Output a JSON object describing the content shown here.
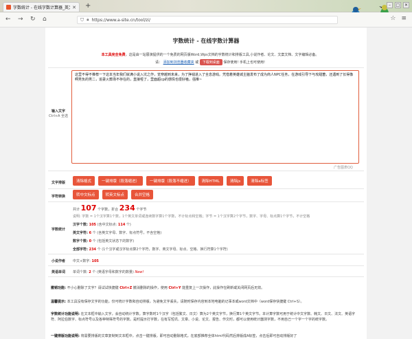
{
  "browser": {
    "tab_title": "字数统计 - 在线字数计算器_英文字...",
    "new_tab": "+",
    "url": "https://www.a-site.cn/tool/zi/"
  },
  "page": {
    "title": "字数统计 - 在线字数计算器",
    "intro_bold": "本工具完全免费",
    "intro_text": "，这是由一站展演提供的一个免费的网页版Word,Wps文档的字数统计和排版工具,小说作者、论文、文案文档、文字编辑必备。",
    "intro2_prefix": "请：",
    "intro2_link": "添加到浏览器收藏夹",
    "intro2_or": "或",
    "intro2_button": "下载到桌面",
    "intro2_suffix": "保存使用! 手机上也可使用!"
  },
  "input": {
    "label": "输入文字",
    "label_sub": "Ctrl+A 全选",
    "text": "这里不得不推荐一下这本当年我们就满小说入坑之作，览穿越到未来，为了挣钱进入了全息游戏。凭借着英雄城主脑发布了成为商人NPC任务，在游戏引导下与攻甜菌，还遇到了长得像啊男负的男二，追妻火葬场不存在的，直接哑了，里面超cp的感情也很好嗑，强推~",
    "ad_note": "广告图表QQ"
  },
  "format": {
    "label": "文字排版",
    "buttons": [
      "清除格式",
      "一键排版（段落缩进）",
      "一键排版（段落不缩进）",
      "清除HTML",
      "清除js",
      "清除a标签"
    ]
  },
  "punct": {
    "label": "字符转换",
    "buttons": [
      "转中文标点",
      "转英文标点",
      "合并空格"
    ]
  },
  "stats": {
    "label": "字数统计",
    "total_prefix": "共计",
    "total": "107",
    "total_unit": "个字数，折合",
    "bytes": "234",
    "bytes_unit": "个字节",
    "explain": "说明: 字数 = 1个汉字算1个数，1个英文单词或连续数字算1个字数，不计标点和空格；字节 = 1个汉字算2个字节，数字、字母、标点算1个字节，不计空格",
    "chinese_label": "汉字个数:",
    "chinese": "105",
    "chinese_mid": "(含中文标点:",
    "chinese_punct": "114",
    "chinese_end": "个)",
    "english_label": "英文字符:",
    "english": "6",
    "english_note": "个 (含英文字母、数字、标点符号，不含空格)",
    "digit_label": "数字个数:",
    "digit": "0",
    "digit_note": "个 (包括英文状态下的数字)",
    "all_label": "全部字符:",
    "all": "234",
    "all_note": "个 (1个汉字或汉字标点算2个字符，数字、英文字母、标点、空格、换行符算1个字符)"
  },
  "novel": {
    "label": "小说作者",
    "text": "中文+数字:",
    "value": "105"
  },
  "english_words": {
    "label": "英语单词",
    "text": "单词个数:",
    "value": "2",
    "note": "个 (英语字母和数字的数量)",
    "new": "New!"
  },
  "notes": [
    {
      "title": "撤销功能:",
      "text": "不小心删除了文字？请试试快捷键",
      "hl": "Ctrl+Z",
      "text2": "撤消删除的操作，使用",
      "hl2": "Ctrl+Y",
      "text3": "能重复上一次操作，此操作在刷新或关闭网页后无效。"
    },
    {
      "title": "温馨提示:",
      "text": "本工具没有保存文字的功能，仅可统计字数和自动排版，为避免文字丢失，请随时保存内容到本地电脑的记事本或word文档中（word保存快捷键 Ctrl+S）。"
    },
    {
      "title": "字数统计功能说明:",
      "text": "在文本框中输入文字，会自动统计字数。算字数时1个汉字（包括繁文、日文）算为2个英文字节，换行算1个英文字节。本计算字数可用于统计中文字数、韩文、日文、法文、英语字符、阿拉伯数字、标点符号以及各种特殊符号的字数。是时提示打字数，在有写短讯、文章、小说、论文、报告、作文时，都可以使用统计器测字数，不用自己一个字一个字的统字数。"
    },
    {
      "title": "一键排版功能说明:",
      "text": "将需要排版的文章复制到文本框中，点击一键排版，即可自动删除格式，在底部推荐全体html代码然后排版成A标签，点击后即可自动排版好了"
    }
  ],
  "nav_icons": [
    "back-icon",
    "forward-icon",
    "refresh-icon",
    "home-icon",
    "shield-icon",
    "lock-icon",
    "star-icon",
    "menu-icon"
  ]
}
